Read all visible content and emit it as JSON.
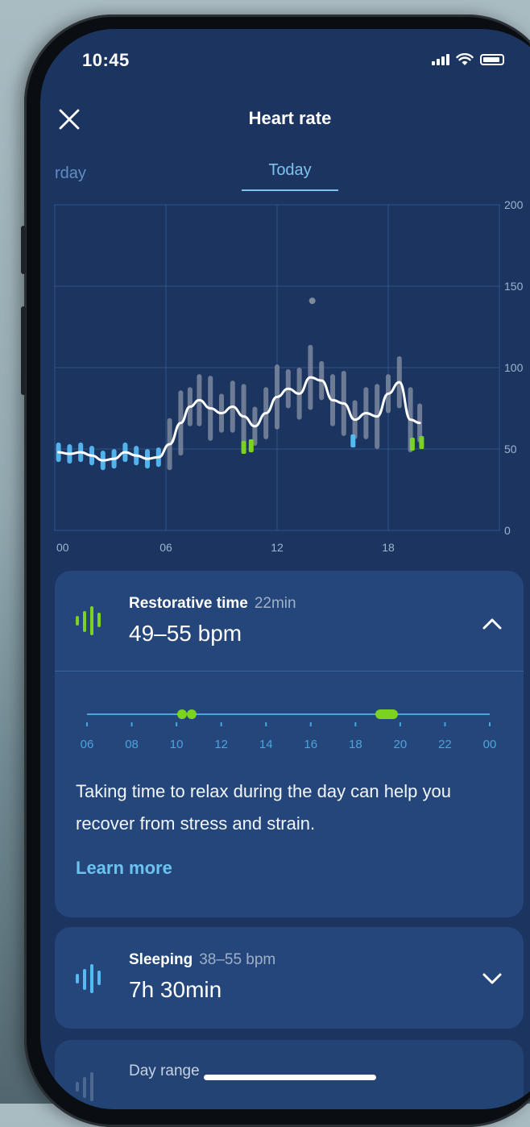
{
  "status_bar": {
    "time": "10:45"
  },
  "header": {
    "title": "Heart rate"
  },
  "tabs": [
    {
      "label": "rday"
    },
    {
      "label": "Today"
    }
  ],
  "colors": {
    "accent": "#7cc4ee",
    "restorative": "#7bd21f",
    "sleeping": "#55b9f2",
    "background": "#1c3560"
  },
  "chart_data": {
    "type": "line",
    "x_ticks": [
      "00",
      "06",
      "12",
      "18"
    ],
    "y_ticks": [
      "200",
      "150",
      "100",
      "50",
      "0"
    ],
    "ylim": [
      0,
      200
    ],
    "xlim": [
      0,
      24
    ],
    "series": [
      {
        "x": [
          0.2,
          0.8,
          1.4,
          2.0,
          2.6,
          3.2,
          3.8,
          4.4,
          5.0,
          5.6,
          6.2,
          6.8,
          7.3,
          7.8,
          8.4,
          9.0,
          9.6,
          10.2,
          10.8,
          11.4,
          12.0,
          12.6,
          13.2,
          13.8,
          14.4,
          15.0,
          15.6,
          16.2,
          16.8,
          17.4,
          18.0,
          18.6,
          19.2,
          19.7
        ],
        "y": [
          48,
          47,
          48,
          46,
          43,
          44,
          48,
          46,
          44,
          45,
          53,
          66,
          76,
          80,
          75,
          72,
          76,
          70,
          64,
          72,
          82,
          87,
          84,
          94,
          92,
          80,
          78,
          68,
          72,
          70,
          84,
          91,
          68,
          66
        ]
      }
    ],
    "bars": [
      {
        "x": 13.9,
        "y": 141
      }
    ]
  },
  "restorative": {
    "title": "Restorative time",
    "duration": "22min",
    "range": "49–55 bpm",
    "timeline_ticks": [
      "06",
      "08",
      "10",
      "12",
      "14",
      "16",
      "18",
      "20",
      "22",
      "00"
    ],
    "description": "Taking time to relax during the day can help you recover from stress and strain.",
    "link": "Learn more"
  },
  "sleeping": {
    "title": "Sleeping",
    "range": "38–55 bpm",
    "duration": "7h 30min"
  },
  "day_range": {
    "title": "Day range"
  }
}
